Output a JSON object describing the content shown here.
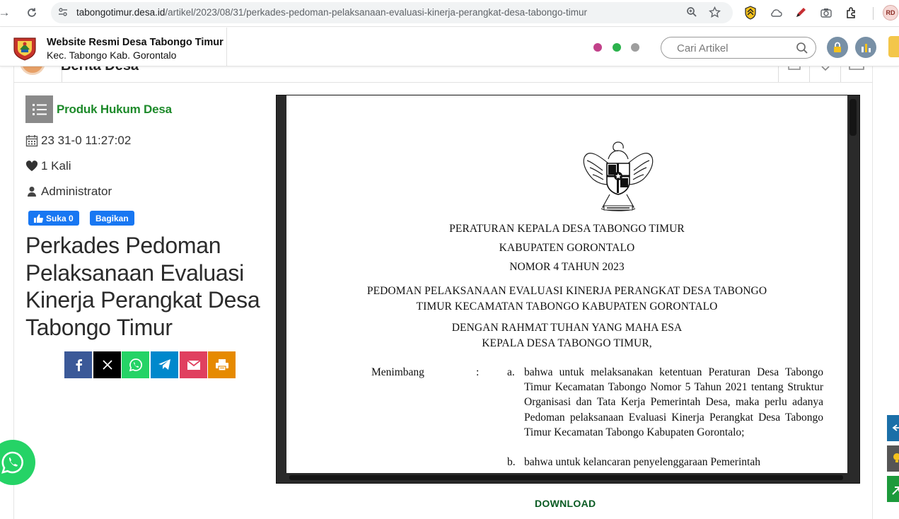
{
  "browser": {
    "url_host": "tabongotimur.desa.id",
    "url_path": "/artikel/2023/08/31/perkades-pedoman-pelaksanaan-evaluasi-kinerja-perangkat-desa-tabongo-timur",
    "profile_initials": "RD"
  },
  "header": {
    "title": "Website Resmi Desa Tabongo Timur",
    "subtitle": "Kec. Tabongo Kab. Gorontalo",
    "search_placeholder": "Cari Artikel",
    "dot_colors": [
      "#c2418a",
      "#2bb24c",
      "#9e9e9e"
    ]
  },
  "section": {
    "title": "Berita Desa"
  },
  "article": {
    "category": "Produk Hukum Desa",
    "date": "23 31-0 11:27:02",
    "views": "1 Kali",
    "author": "Administrator",
    "fb_like": "Suka 0",
    "fb_share": "Bagikan",
    "title": "Perkades Pedoman Pelaksanaan Evaluasi Kinerja Perangkat Desa Tabongo Timur",
    "download_label": "DOWNLOAD"
  },
  "share_buttons": [
    {
      "name": "facebook-share-button",
      "icon": "facebook-icon",
      "color": "#3b5998"
    },
    {
      "name": "x-share-button",
      "icon": "x-icon",
      "color": "#000000"
    },
    {
      "name": "whatsapp-share-button",
      "icon": "whatsapp-icon",
      "color": "#25d366"
    },
    {
      "name": "telegram-share-button",
      "icon": "telegram-icon",
      "color": "#0088cc"
    },
    {
      "name": "email-share-button",
      "icon": "email-icon",
      "color": "#e0405f"
    },
    {
      "name": "print-share-button",
      "icon": "print-icon",
      "color": "#e68a00"
    }
  ],
  "document": {
    "heading1": "PERATURAN KEPALA DESA TABONGO TIMUR",
    "heading2": "KABUPATEN GORONTALO",
    "heading3": "NOMOR 4  TAHUN 2023",
    "subject1": "PEDOMAN PELAKSANAAN EVALUASI KINERJA PERANGKAT DESA TABONGO",
    "subject2": "TIMUR KECAMATAN TABONGO KABUPATEN GORONTALO",
    "blessing1": "DENGAN RAHMAT TUHAN YANG MAHA ESA",
    "blessing2": "KEPALA DESA TABONGO TIMUR,",
    "considering_label": "Menimbang",
    "colon": ":",
    "item_a_marker": "a.",
    "item_a_text": "bahwa untuk melaksanakan ketentuan Peraturan Desa Tabongo Timur Kecamatan Tabongo Nomor 5 Tahun 2021 tentang Struktur Organisasi dan Tata Kerja Pemerintah Desa, maka perlu adanya Pedoman pelaksanaan Evaluasi Kinerja Perangkat Desa Tabongo Timur Kecamatan Tabongo Kabupaten Gorontalo;",
    "item_b_marker": "b.",
    "item_b_text": "bahwa untuk kelancaran penyelenggaraan Pemerintah"
  }
}
